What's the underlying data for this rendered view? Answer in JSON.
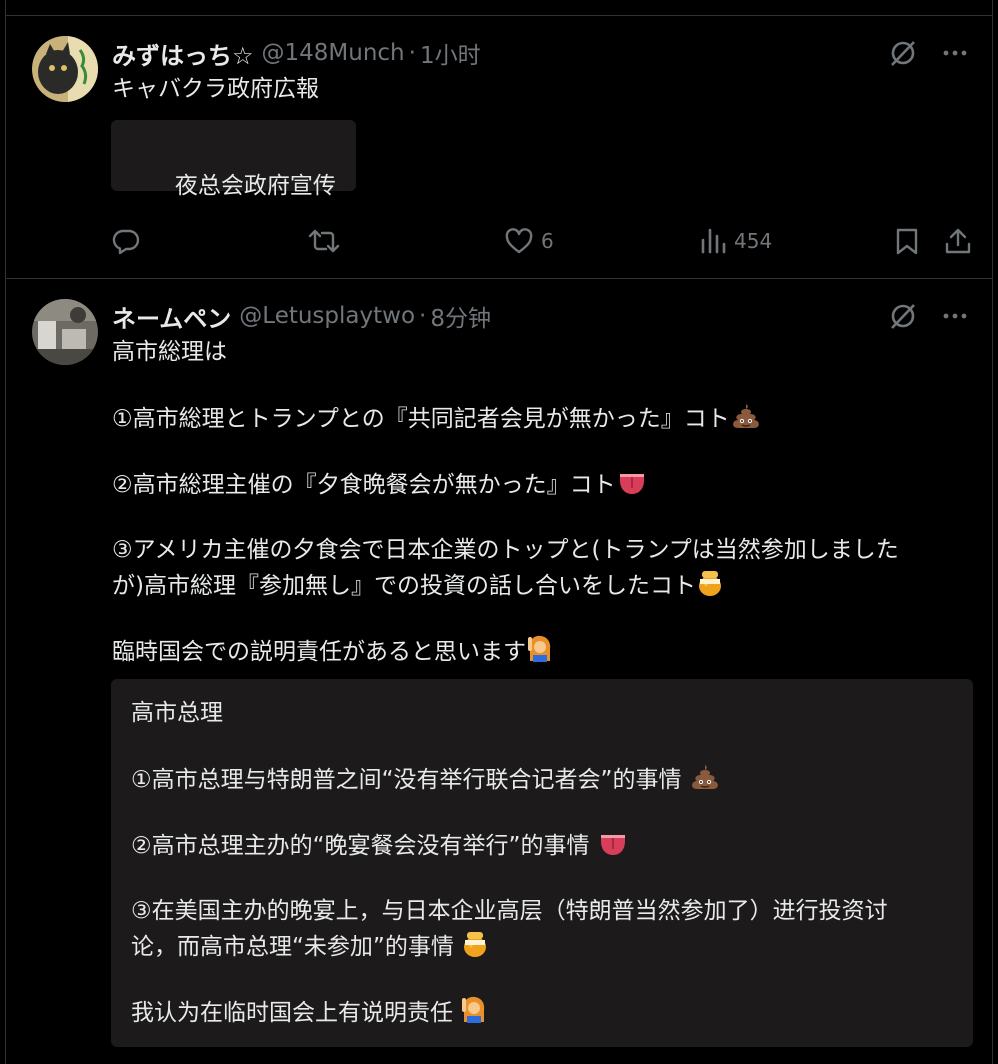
{
  "posts": [
    {
      "name": "みずはっち☆",
      "handle": "@148Munch",
      "time": "1小时",
      "text": "キャバクラ政府広報",
      "translation": "夜总会政府宣传",
      "likes": "6",
      "views": "454"
    },
    {
      "name": "ネームペン",
      "handle": "@Letusplaytwo",
      "time": "8分钟",
      "text_lines": [
        "高市総理は",
        "①高市総理とトランプとの『共同記者会見が無かった』コト",
        "②高市総理主催の『夕食晩餐会が無かった』コト",
        "③アメリカ主催の夕食会で日本企業のトップと(トランプは当然参加しました",
        "が)高市総理『参加無し』での投資の話し合いをしたコト",
        "臨時国会での説明責任があると思います"
      ],
      "translation_lines": [
        "高市总理",
        "①高市总理与特朗普之间“没有举行联合记者会”的事情",
        "②高市总理主办的“晚宴餐会没有举行”的事情",
        "③在美国主办的晚宴上，与日本企业高层（特朗普当然参加了）进行投资讨",
        "论，而高市总理“未参加”的事情",
        "我认为在临时国会上有说明责任"
      ]
    }
  ],
  "separator": "·",
  "icons": {
    "grok": "grok-icon",
    "more": "more-icon",
    "reply": "reply-icon",
    "retweet": "retweet-icon",
    "like": "heart-icon",
    "views": "views-icon",
    "bookmark": "bookmark-icon",
    "share": "share-icon",
    "poop": "poop-emoji",
    "tongue": "tongue-emoji",
    "honey": "honey-pot-emoji",
    "raising": "person-raising-hand-emoji"
  },
  "colors": {
    "background": "#000000",
    "text": "#e7e9ea",
    "muted": "#71767b",
    "border": "#2f3336",
    "translation_bg": "#1c1a1b"
  }
}
